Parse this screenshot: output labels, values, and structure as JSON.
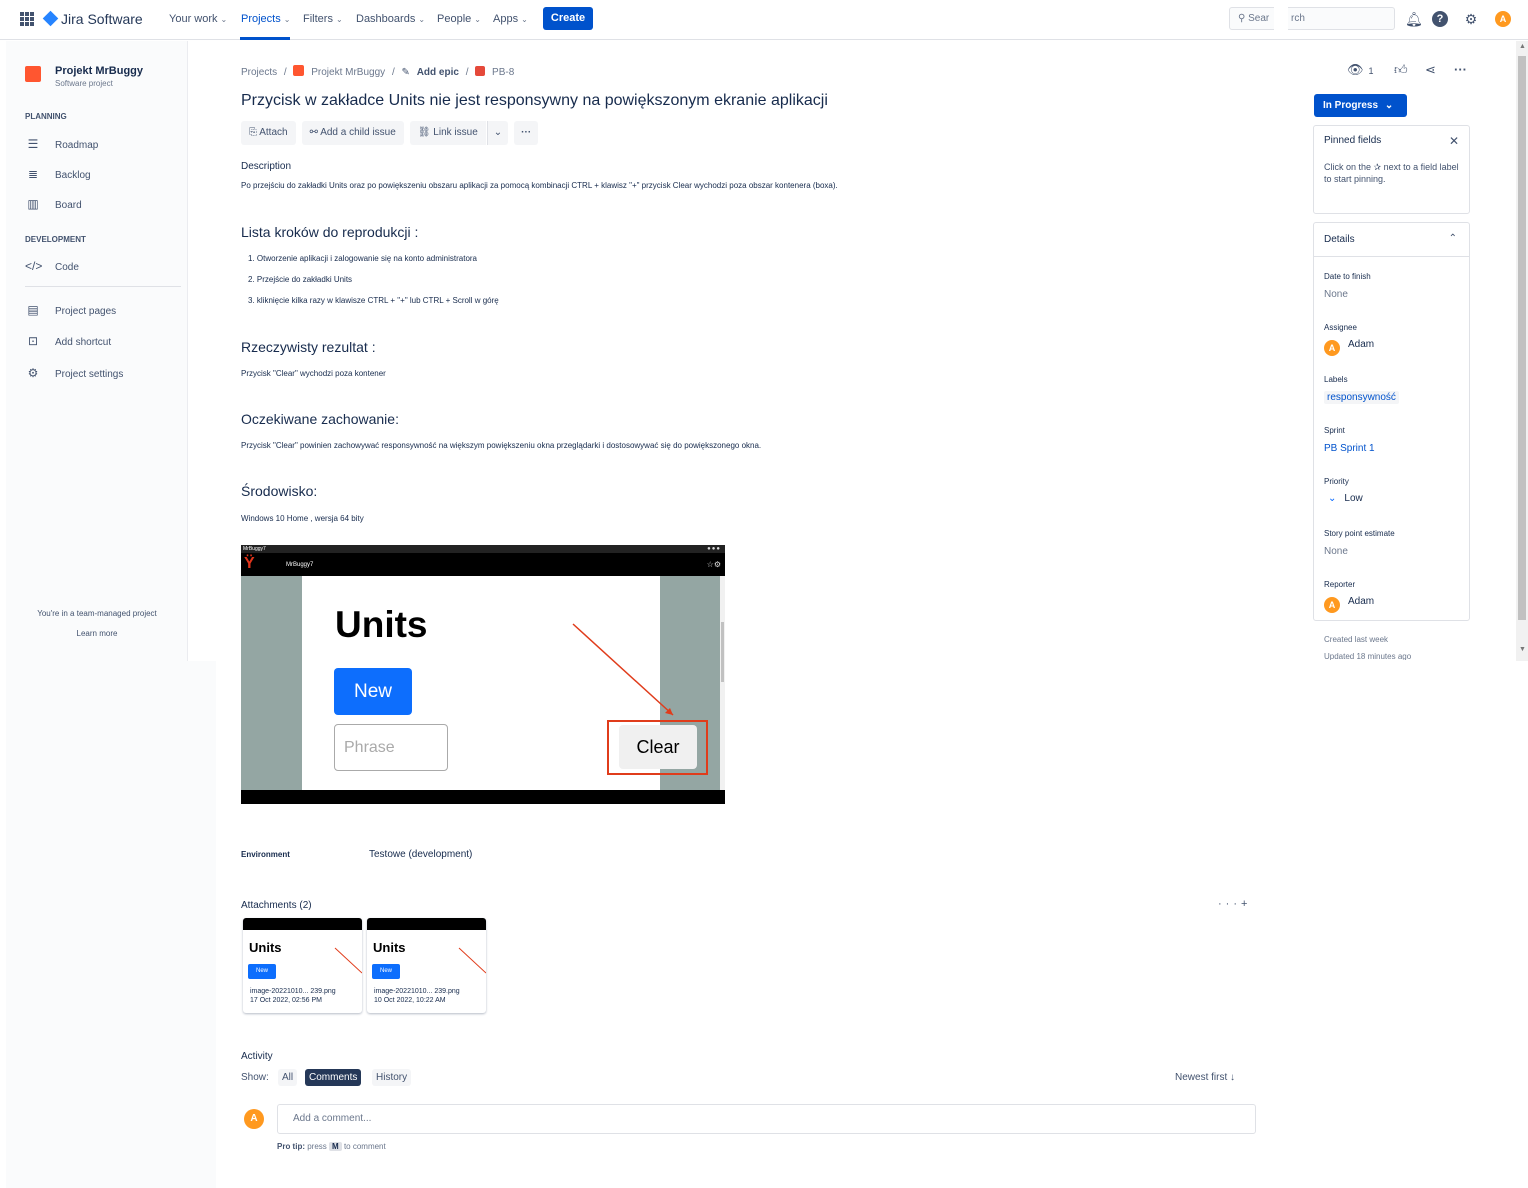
{
  "topnav": {
    "product": "Jira Software",
    "items": [
      "Your work",
      "Projects",
      "Filters",
      "Dashboards",
      "People",
      "Apps"
    ],
    "create": "Create",
    "search_placeholder": "Sear",
    "search_tail": "rch",
    "avatar_initial": "A"
  },
  "sidebar": {
    "project_name": "Projekt MrBuggy",
    "project_type": "Software project",
    "planning_title": "PLANNING",
    "planning": [
      "Roadmap",
      "Backlog",
      "Board"
    ],
    "development_title": "DEVELOPMENT",
    "development": [
      "Code"
    ],
    "extra": [
      "Project pages",
      "Add shortcut",
      "Project settings"
    ],
    "footer": "You're in a team-managed project",
    "learn_more": "Learn more"
  },
  "issue": {
    "breadcrumbs": [
      "Projects",
      "/",
      "Projekt MrBuggy",
      "/",
      "Add epic",
      "/",
      "PB-8"
    ],
    "title": "Przycisk w zakładce Units nie jest responsywny na powiększonym ekranie aplikacji",
    "buttons": [
      "Attach",
      "Add a child issue",
      "Link issue"
    ],
    "description_label": "Description",
    "description": "Po przejściu do zakładki Units oraz po powiększeniu obszaru aplikacji za pomocą kombinacji CTRL + klawisz \"+\" przycisk Clear wychodzi poza obszar kontenera (boxa).",
    "steps_heading": "Lista kroków do reprodukcji :",
    "steps": [
      "1. Otworzenie aplikacji i zalogowanie się na konto administratora",
      "2. Przejście do zakładki Units",
      "3. kliknięcie kilka razy w klawisze CTRL + \"+\"  lub CTRL + Scroll w górę"
    ],
    "actual_heading": "Rzeczywisty rezultat :",
    "actual": "Przycisk \"Clear\" wychodzi poza kontener",
    "expected_heading": "Oczekiwane zachowanie:",
    "expected": "Przycisk \"Clear\" powinien zachowywać responsywność na większym powiększeniu okna przeglądarki i dostosowywać się do powiększonego okna.",
    "env_heading": "Środowisko:",
    "env_text": "Windows 10 Home , wersja 64 bity",
    "screenshot": {
      "window_title": "MrBuggy7",
      "app_name": "MrBuggy7",
      "heading": "Units",
      "new_button": "New",
      "phrase_placeholder": "Phrase",
      "clear_button": "Clear"
    },
    "environment_label": "Environment",
    "environment_value": "Testowe (development)",
    "attachments_heading": "Attachments (2)",
    "attachments": [
      {
        "name": "image-20221010... 239.png",
        "date": "17 Oct 2022, 02:56 PM",
        "thumb_heading": "Units",
        "thumb_button": "New"
      },
      {
        "name": "image-20221010... 239.png",
        "date": "10 Oct 2022, 10:22 AM",
        "thumb_heading": "Units",
        "thumb_button": "New"
      }
    ],
    "activity_heading": "Activity",
    "show_label": "Show:",
    "filters": [
      "All",
      "Comments",
      "History"
    ],
    "active_filter": "Comments",
    "sort": "Newest first ↓",
    "comment_placeholder": "Add a comment...",
    "protip_label": "Pro tip:",
    "protip_press": "press",
    "protip_key": "M",
    "protip_rest": "to comment",
    "user_initial": "A"
  },
  "right_panel": {
    "watchers": "1",
    "status": "In Progress",
    "pinned_title": "Pinned fields",
    "pinned_text": "Click on the ✰ next to a field label to start pinning.",
    "details_title": "Details",
    "fields": [
      {
        "label": "Date to finish",
        "value": "None",
        "kind": "none"
      },
      {
        "label": "Assignee",
        "value": "Adam",
        "kind": "user"
      },
      {
        "label": "Labels",
        "value": "responsywność",
        "kind": "tag"
      },
      {
        "label": "Sprint",
        "value": "PB Sprint 1",
        "kind": "link"
      },
      {
        "label": "Priority",
        "value": "Low",
        "kind": "priority"
      },
      {
        "label": "Story point estimate",
        "value": "None",
        "kind": "none"
      },
      {
        "label": "Reporter",
        "value": "Adam",
        "kind": "user"
      }
    ],
    "created": "Created last week",
    "updated": "Updated 18 minutes ago"
  },
  "colors": {
    "brand": "#0052cc",
    "avatar": "#ff991f",
    "link": "#0052cc",
    "highlight_box": "#e03c1b"
  }
}
